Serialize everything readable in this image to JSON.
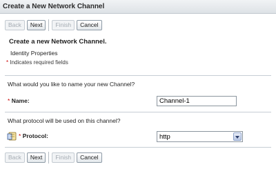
{
  "window": {
    "title": "Create a New Network Channel"
  },
  "toolbar": {
    "back": "Back",
    "next": "Next",
    "finish": "Finish",
    "cancel": "Cancel"
  },
  "page": {
    "heading": "Create a new Network Channel.",
    "section": "Identity Properties",
    "required_note": "Indicates required fields",
    "required_marker": "*"
  },
  "name_field": {
    "question": "What would you like to name your new Channel?",
    "label": "Name:",
    "value": "Channel-1"
  },
  "protocol_field": {
    "question": "What protocol will be used on this channel?",
    "label": "Protocol:",
    "selected": "http",
    "icon": "help-book-icon"
  },
  "colors": {
    "required": "#cc0000",
    "title_bg": "#e6e9ec"
  }
}
